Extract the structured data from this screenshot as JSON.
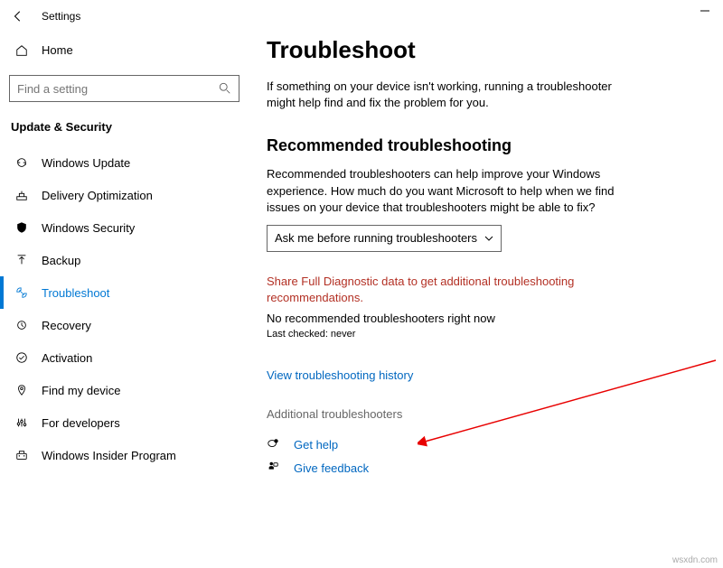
{
  "window": {
    "title": "Settings"
  },
  "home": {
    "label": "Home"
  },
  "search": {
    "placeholder": "Find a setting"
  },
  "section": {
    "header": "Update & Security"
  },
  "nav": [
    {
      "label": "Windows Update"
    },
    {
      "label": "Delivery Optimization"
    },
    {
      "label": "Windows Security"
    },
    {
      "label": "Backup"
    },
    {
      "label": "Troubleshoot"
    },
    {
      "label": "Recovery"
    },
    {
      "label": "Activation"
    },
    {
      "label": "Find my device"
    },
    {
      "label": "For developers"
    },
    {
      "label": "Windows Insider Program"
    }
  ],
  "main": {
    "title": "Troubleshoot",
    "intro": "If something on your device isn't working, running a troubleshooter might help find and fix the problem for you.",
    "recommended": {
      "heading": "Recommended troubleshooting",
      "desc": "Recommended troubleshooters can help improve your Windows experience. How much do you want Microsoft to help when we find issues on your device that troubleshooters might be able to fix?",
      "dropdown": "Ask me before running troubleshooters",
      "warning": "Share Full Diagnostic data to get additional troubleshooting recommendations.",
      "status": "No recommended troubleshooters right now",
      "last_checked": "Last checked: never"
    },
    "history_link": "View troubleshooting history",
    "additional": "Additional troubleshooters",
    "help": {
      "get": "Get help",
      "feedback": "Give feedback"
    }
  },
  "watermark": "wsxdn.com"
}
